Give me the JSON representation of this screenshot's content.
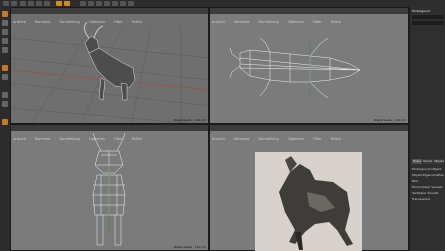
{
  "app": {
    "title": ""
  },
  "viewports": {
    "top_left": {
      "menus": [
        "Ansicht",
        "Kameras",
        "Darstellung",
        "Optionen",
        "Filter",
        "Tafeln"
      ],
      "footer": "Rasterweite : 100 cm"
    },
    "top_right": {
      "menus": [
        "Ansicht",
        "Kameras",
        "Darstellung",
        "Optionen",
        "Filter",
        "Tafeln"
      ],
      "footer": "Rasterweite : 100 cm"
    },
    "bottom_left": {
      "menus": [
        "Ansicht",
        "Kameras",
        "Darstellung",
        "Optionen",
        "Filter",
        "Tafeln"
      ],
      "footer": "Rasterweite : 100 cm"
    },
    "bottom_right": {
      "menus": [
        "Ansicht",
        "Kameras",
        "Darstellung",
        "Optionen",
        "Filter",
        "Tafeln"
      ],
      "footer": "Rasterweite : 100 cm"
    }
  },
  "right_panel": {
    "top_label": "Hintergrund",
    "tabs": [
      "Basis",
      "Koord.",
      "Objekt"
    ],
    "rows": [
      "Hintergrund-Objekt",
      "Objekt-Eigenschaften",
      "Bild",
      "Horizontaler Versatz",
      "Vertikaler Versatz",
      "Transparenz"
    ]
  },
  "colors": {
    "accent": "#d38a2a",
    "viewport_bg": "#7a7a7a",
    "panel_bg": "#2f2f2f"
  }
}
